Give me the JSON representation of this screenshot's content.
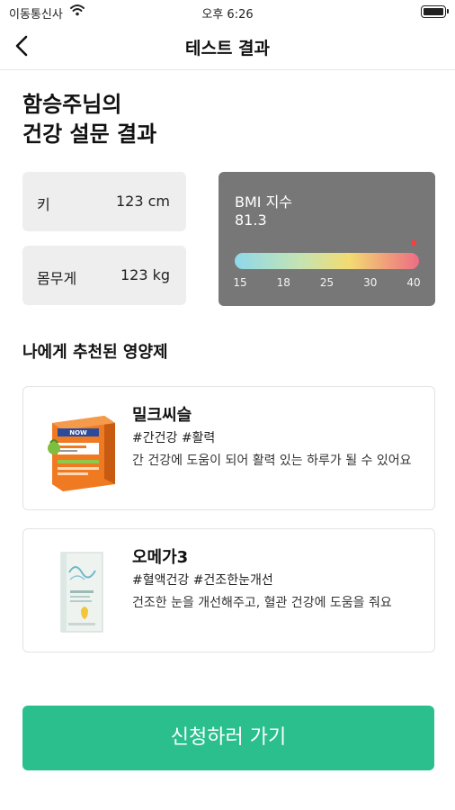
{
  "status_bar": {
    "carrier": "이동통신사",
    "time": "오후 6:26"
  },
  "nav": {
    "title": "테스트 결과"
  },
  "headline": {
    "line1": "함승주님의",
    "line2": "건강 설문 결과"
  },
  "stats": {
    "height": {
      "label": "키",
      "value": "123 cm"
    },
    "weight": {
      "label": "몸무게",
      "value": "123 kg"
    }
  },
  "bmi": {
    "label": "BMI 지수",
    "value": "81.3",
    "scale": [
      "15",
      "18",
      "25",
      "30",
      "40"
    ],
    "colors": [
      "#8fd8ea",
      "#c4e3b4",
      "#f2dc72",
      "#f0a07a",
      "#ec6d84"
    ],
    "marker_color": "#ff3b3b"
  },
  "recommend": {
    "title": "나에게 추천된 영양제",
    "items": [
      {
        "name": "밀크씨슬",
        "tags": "#간건강 #활력",
        "desc": "간 건강에 도움이 되어 활력 있는 하루가 될 수 있어요",
        "image": "milk-thistle-box"
      },
      {
        "name": "오메가3",
        "tags": "#혈액건강 #건조한눈개선",
        "desc": "건조한 눈을 개선해주고, 혈관 건강에 도움을 줘요",
        "image": "omega3-box"
      }
    ]
  },
  "cta": {
    "label": "신청하러 가기",
    "color": "#2abf8c"
  }
}
